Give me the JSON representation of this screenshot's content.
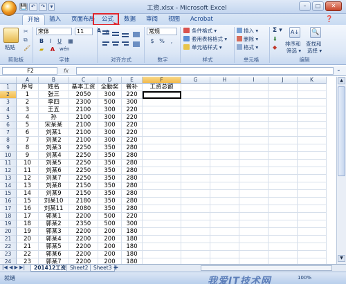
{
  "window": {
    "title": "工资.xlsx - Microsoft Excel",
    "minimize": "–",
    "restore": "□",
    "close": "✕"
  },
  "qat": {
    "save": "💾",
    "undo": "↶",
    "redo": "↷",
    "more": "▾"
  },
  "tabs": [
    {
      "label": "开始",
      "active": true
    },
    {
      "label": "插入"
    },
    {
      "label": "页面布局"
    },
    {
      "label": "公式",
      "highlighted": true
    },
    {
      "label": "数据"
    },
    {
      "label": "审阅"
    },
    {
      "label": "视图"
    },
    {
      "label": "Acrobat"
    }
  ],
  "ribbon": {
    "clipboard": {
      "paste": "粘贴",
      "label": "剪贴板"
    },
    "font": {
      "name": "宋体",
      "size": "11",
      "bold": "B",
      "italic": "I",
      "underline": "U",
      "label": "字体",
      "grow": "A",
      "shrink": "A",
      "wen": "wén"
    },
    "align": {
      "label": "对齐方式"
    },
    "number": {
      "format": "常规",
      "currency": "%",
      "label": "数字"
    },
    "styles": {
      "cond": "条件格式 ▾",
      "table": "套用表格格式 ▾",
      "cell": "单元格样式 ▾",
      "label": "样式"
    },
    "cells": {
      "insert": "插入 ▾",
      "delete": "删除 ▾",
      "format": "格式 ▾",
      "label": "单元格"
    },
    "editing": {
      "sigma": "Σ ▾",
      "sort": "排序和",
      "sort2": "筛选 ▾",
      "find": "查找和",
      "find2": "选择 ▾",
      "label": "编辑"
    }
  },
  "formula_bar": {
    "name_box": "F2",
    "fx": "fx",
    "value": ""
  },
  "columns": [
    "A",
    "B",
    "C",
    "D",
    "E",
    "F",
    "G",
    "H",
    "I",
    "J",
    "K"
  ],
  "headers_row": [
    "序号",
    "姓名",
    "基本工资",
    "全勤奖",
    "餐补",
    "工资总额"
  ],
  "rows": [
    [
      "1",
      "张三",
      "2050",
      "300",
      "220"
    ],
    [
      "2",
      "李四",
      "2300",
      "500",
      "300"
    ],
    [
      "3",
      "王五",
      "2100",
      "300",
      "220"
    ],
    [
      "4",
      "孙",
      "2100",
      "300",
      "220"
    ],
    [
      "5",
      "宋某某",
      "2100",
      "300",
      "220"
    ],
    [
      "6",
      "刘某1",
      "2100",
      "300",
      "220"
    ],
    [
      "7",
      "刘某2",
      "2100",
      "300",
      "220"
    ],
    [
      "8",
      "刘某3",
      "2250",
      "350",
      "280"
    ],
    [
      "9",
      "刘某4",
      "2250",
      "350",
      "280"
    ],
    [
      "10",
      "刘某5",
      "2250",
      "350",
      "280"
    ],
    [
      "11",
      "刘某6",
      "2250",
      "350",
      "280"
    ],
    [
      "12",
      "刘某7",
      "2250",
      "350",
      "280"
    ],
    [
      "13",
      "刘某8",
      "2150",
      "350",
      "280"
    ],
    [
      "14",
      "刘某9",
      "2150",
      "350",
      "280"
    ],
    [
      "15",
      "刘某10",
      "2180",
      "350",
      "280"
    ],
    [
      "16",
      "刘某11",
      "2080",
      "350",
      "280"
    ],
    [
      "17",
      "郭某1",
      "2200",
      "500",
      "220"
    ],
    [
      "18",
      "郭某2",
      "2350",
      "500",
      "300"
    ],
    [
      "19",
      "郭某3",
      "2200",
      "200",
      "180"
    ],
    [
      "20",
      "郭某4",
      "2200",
      "200",
      "180"
    ],
    [
      "21",
      "郭某5",
      "2200",
      "200",
      "180"
    ],
    [
      "22",
      "郭某6",
      "2200",
      "200",
      "180"
    ],
    [
      "23",
      "郭某7",
      "2200",
      "200",
      "180"
    ]
  ],
  "row_numbers": [
    "1",
    "2",
    "3",
    "4",
    "5",
    "6",
    "7",
    "8",
    "9",
    "10",
    "11",
    "12",
    "13",
    "14",
    "15",
    "16",
    "17",
    "18",
    "19",
    "20",
    "21",
    "22",
    "23",
    "24",
    "25"
  ],
  "sheets": [
    {
      "label": "201412工资",
      "active": true
    },
    {
      "label": "Sheet2"
    },
    {
      "label": "Sheet3"
    }
  ],
  "status": {
    "text": "就绪",
    "zoom": "100%"
  },
  "watermark": "我爱IT技术网",
  "colors": {
    "accent": "#15428b",
    "highlight": "#e0242c",
    "selected_header": "#f2b94a"
  }
}
